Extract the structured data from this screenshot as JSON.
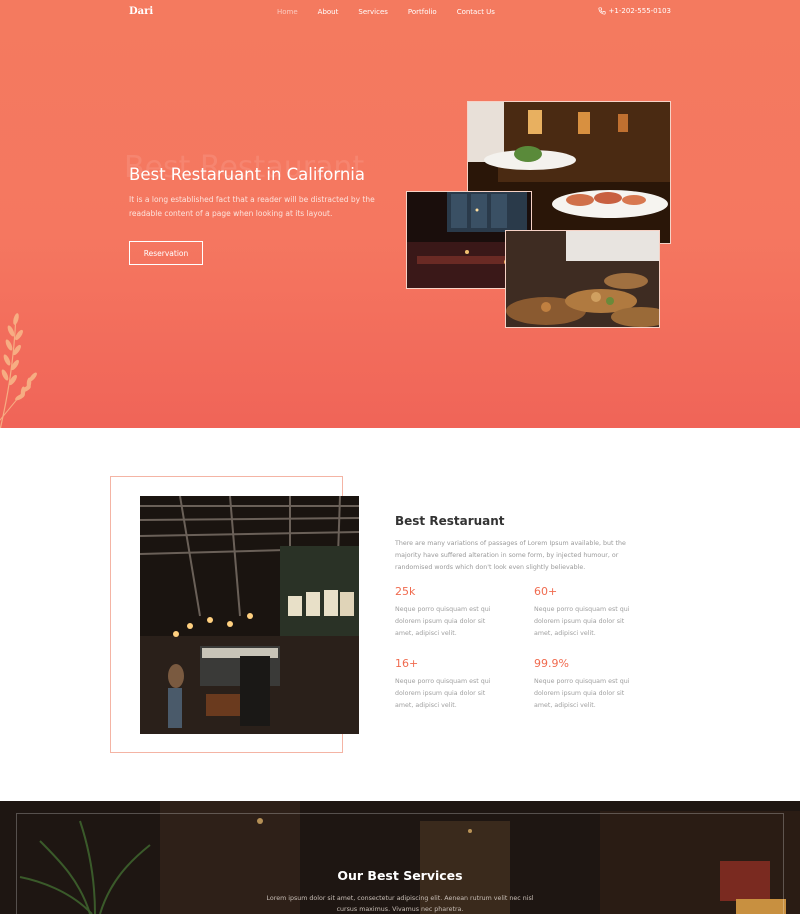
{
  "nav": {
    "logo": "Dari",
    "items": [
      {
        "label": "Home",
        "active": true
      },
      {
        "label": "About",
        "active": false
      },
      {
        "label": "Services",
        "active": false
      },
      {
        "label": "Portfolio",
        "active": false
      },
      {
        "label": "Contact Us",
        "active": false
      }
    ],
    "phone": "+1-202-555-0103",
    "phone_icon": "phone-icon"
  },
  "hero": {
    "ghost_title": "Best Restaurant",
    "title": "Best Restaruant in California",
    "text": "It is a long established fact that a reader will be distracted by the readable content of a page when looking at its layout.",
    "button": "Reservation"
  },
  "about": {
    "title": "Best Restaruant",
    "text": "There are many variations of passages of Lorem Ipsum available, but the majority have suffered alteration in some form, by injected humour, or randomised words which don't look even slightly believable.",
    "stats": [
      {
        "value": "25k",
        "desc": "Neque porro quisquam est qui dolorem ipsum quia dolor sit amet, adipisci velit."
      },
      {
        "value": "60+",
        "desc": "Neque porro quisquam est qui dolorem ipsum quia dolor sit amet, adipisci velit."
      },
      {
        "value": "16+",
        "desc": "Neque porro quisquam est qui dolorem ipsum quia dolor sit amet, adipisci velit."
      },
      {
        "value": "99.9%",
        "desc": "Neque porro quisquam est qui dolorem ipsum quia dolor sit amet, adipisci velit."
      }
    ]
  },
  "services": {
    "title": "Our Best Services",
    "text": "Lorem ipsum dolor sit amet, consectetur adipiscing elit. Aenean rutrum velit nec nisl cursus maximus. Vivamus nec pharetra."
  },
  "colors": {
    "accent": "#f06b4f",
    "hero_top": "#f47a5f",
    "hero_bottom": "#f06458"
  }
}
